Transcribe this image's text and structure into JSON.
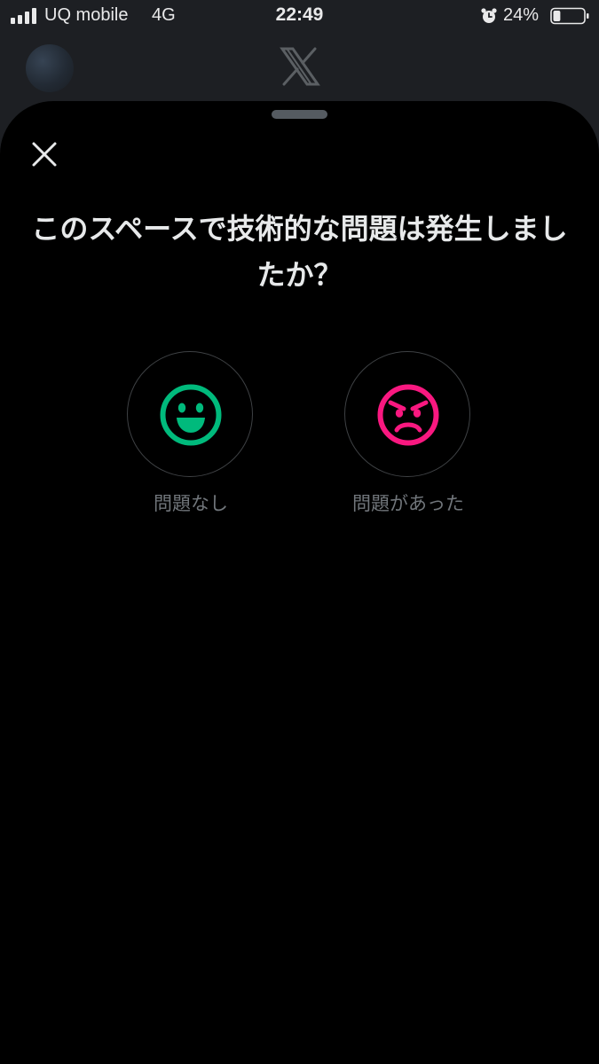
{
  "status_bar": {
    "carrier": "UQ mobile",
    "network": "4G",
    "time": "22:49",
    "battery": "24%",
    "battery_level": 0.24,
    "alarm_icon": "alarm-clock-icon"
  },
  "header": {
    "logo": "x-logo-icon",
    "avatar": "profile-avatar"
  },
  "sheet": {
    "close_icon": "close-icon",
    "title": "このスペースで技術的な問題は発生しましたか？",
    "options": [
      {
        "label": "問題なし",
        "icon": "smiley-face-icon",
        "color": "#00ba7c"
      },
      {
        "label": "問題があった",
        "icon": "angry-face-icon",
        "color": "#f91880"
      }
    ]
  }
}
